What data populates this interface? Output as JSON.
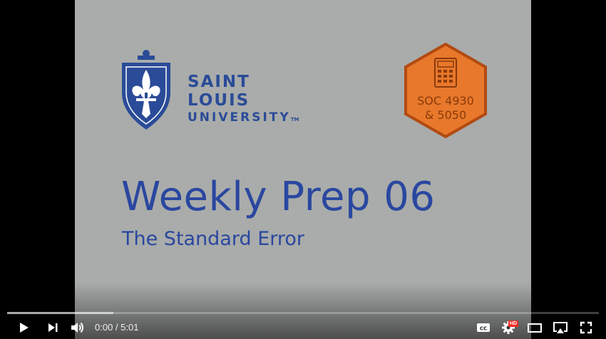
{
  "slide": {
    "university_line1": "SAINT LOUIS",
    "university_line2": "UNIVERSITY",
    "trademark": "TM",
    "course_badge_line1": "SOC 4930",
    "course_badge_line2": "& 5050",
    "title": "Weekly Prep 06",
    "subtitle": "The Standard Error"
  },
  "player": {
    "current_time": "0:00",
    "time_separator": " / ",
    "duration": "5:01",
    "progress_fraction": 0.0,
    "buffered_fraction": 0.18,
    "quality_badge": "HD",
    "controls": {
      "play": "play-icon",
      "next": "next-icon",
      "volume": "volume-icon",
      "captions": "cc-icon",
      "settings": "gear-icon",
      "theater": "theater-icon",
      "cast": "airplay-icon",
      "fullscreen": "fullscreen-icon"
    }
  },
  "colors": {
    "slide_background": "#a9acaa",
    "brand_blue": "#2a47a0",
    "badge_orange": "#e8782b",
    "progress_red": "#ff0000"
  }
}
